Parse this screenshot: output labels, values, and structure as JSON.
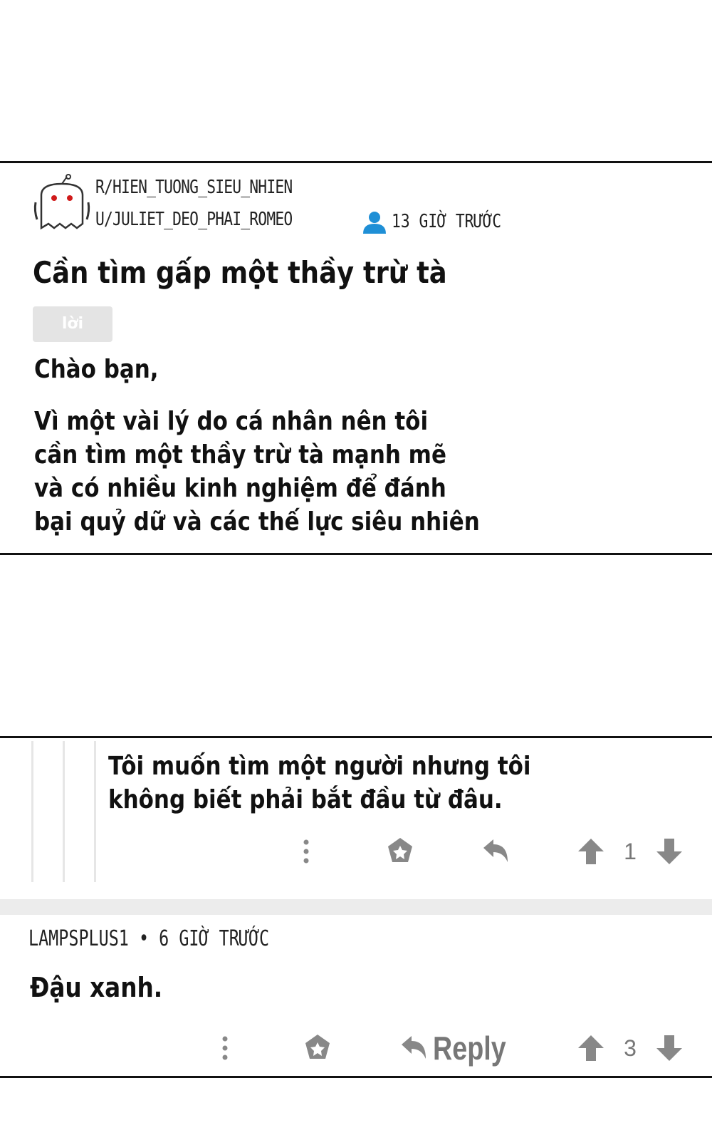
{
  "post": {
    "subreddit": "R/HIEN_TUONG_SIEU_NHIEN",
    "username": "U/JULIET_DEO_PHAI_ROMEO",
    "time": "13 GIỜ TRƯỚC",
    "title": "Cần tìm gấp một thầy trừ tà",
    "flair": "lời khuyên",
    "greeting": "Chào bạn,",
    "body_lines": [
      "Vì một vài lý do cá nhân nên tôi",
      "cần tìm một thầy trừ tà mạnh mẽ",
      "và có nhiều kinh nghiệm để đánh",
      "bại quỷ dữ và các thế lực siêu nhiên"
    ]
  },
  "comment1": {
    "lines": [
      "Tôi muốn tìm một người nhưng tôi",
      "không biết phải bắt đầu từ đâu."
    ],
    "votes": "1"
  },
  "comment2": {
    "author": "LAMPSPLUS1",
    "separator": "•",
    "time": "6 GIỜ TRƯỚC",
    "text": "Đậu xanh.",
    "reply_label": "Reply",
    "votes": "3"
  },
  "colors": {
    "icon_gray": "#777777",
    "person_icon": "#1f8fd6",
    "flair_bg": "#e4e4e4",
    "band": "#ececec"
  },
  "icons": [
    "snoo-avatar-icon",
    "person-icon",
    "more-vertical-icon",
    "award-icon",
    "reply-icon",
    "upvote-icon",
    "downvote-icon"
  ]
}
